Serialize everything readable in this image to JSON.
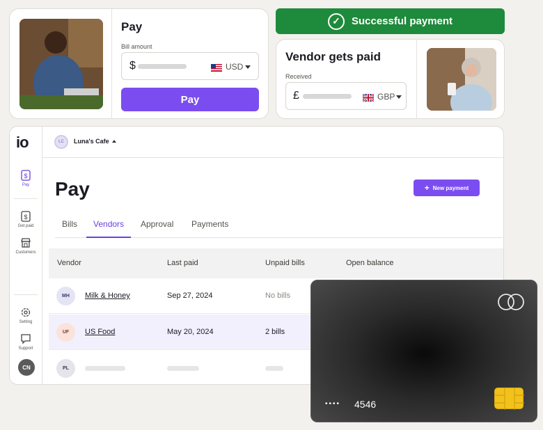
{
  "pay_card": {
    "title": "Pay",
    "bill_amount_label": "Bill amount",
    "currency_symbol": "$",
    "currency_code": "USD",
    "button_label": "Pay"
  },
  "success_banner": {
    "text": "Successful payment"
  },
  "vendor_card": {
    "title": "Vendor gets paid",
    "received_label": "Received",
    "currency_symbol": "£",
    "currency_code": "GBP"
  },
  "app": {
    "logo": "io",
    "rail": {
      "pay": "Pay",
      "get_paid": "Get paid",
      "customers": "Customers",
      "setting": "Setting",
      "support": "Support",
      "user_initials": "CN"
    },
    "org": {
      "initials": "LC",
      "name": "Luna's Cafe"
    },
    "page_title": "Pay",
    "new_payment_label": "New payment",
    "tabs": [
      "Bills",
      "Vendors",
      "Approval",
      "Payments"
    ],
    "table": {
      "headers": [
        "Vendor",
        "Last paid",
        "Unpaid bills",
        "Open balance"
      ],
      "rows": [
        {
          "initials": "MH",
          "vendor": "Milk & Honey",
          "last_paid": "Sep 27, 2024",
          "unpaid": "No bills"
        },
        {
          "initials": "UF",
          "vendor": "US Food",
          "last_paid": "May 20, 2024",
          "unpaid": "2 bills"
        },
        {
          "initials": "PL"
        }
      ]
    }
  },
  "credit_card": {
    "masked": "••••",
    "last4": "4546"
  },
  "colors": {
    "accent": "#7b4df0",
    "success": "#1e8a3b",
    "chip": "#f2c21b"
  }
}
